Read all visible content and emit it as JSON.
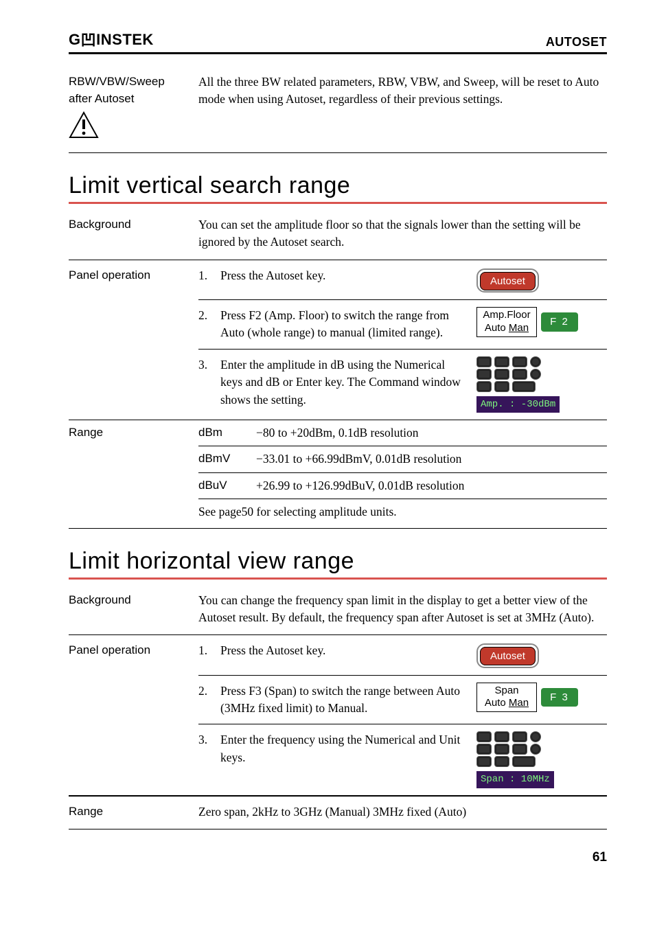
{
  "header": {
    "logo": "GW INSTEK",
    "title": "AUTOSET"
  },
  "rbw_row": {
    "left1": "RBW/VBW/Sweep",
    "left2": "after Autoset",
    "body": "All the three BW related parameters, RBW, VBW, and Sweep, will be reset to Auto mode when using Autoset, regardless of their previous settings."
  },
  "limit_vertical": {
    "heading": "Limit vertical search range",
    "background_label": "Background",
    "background_text": "You can set the amplitude floor so that the signals lower than the setting will be ignored by the Autoset search.",
    "panel_label": "Panel operation",
    "step1_text": "Press the Autoset key.",
    "autoset_label": "Autoset",
    "step2_text": "Press F2 (Amp. Floor) to switch the range from Auto (whole range) to manual (limited range).",
    "soft1_l1": "Amp.Floor",
    "soft1_l2a": "Auto  ",
    "soft1_l2b": "Man",
    "f2_label": "F 2",
    "step3_text": "Enter the amplitude in dB using the Numerical keys and dB or Enter key. The Command window shows the setting.",
    "cmd1": "Amp. : -30dBm",
    "range_label": "Range",
    "range_rows": [
      {
        "unit": "dBm",
        "text": "−80 to +20dBm, 0.1dB resolution"
      },
      {
        "unit": "dBmV",
        "text": "−33.01 to +66.99dBmV, 0.01dB resolution"
      },
      {
        "unit": "dBuV",
        "text": "+26.99 to +126.99dBuV, 0.01dB resolution"
      }
    ],
    "range_footer": "See page50 for selecting amplitude units."
  },
  "limit_horizontal": {
    "heading": "Limit horizontal view range",
    "background_label": "Background",
    "background_text": "You can change the frequency span limit in the display to get a better view of the Autoset result. By default, the frequency span after Autoset is set at 3MHz (Auto).",
    "panel_label": "Panel operation",
    "step1_text": "Press the Autoset key.",
    "autoset_label": "Autoset",
    "step2_text": "Press F3 (Span) to switch the range between Auto (3MHz fixed limit) to Manual.",
    "soft2_l1": "Span",
    "soft2_l2a": "Auto ",
    "soft2_l2b": "Man",
    "f3_label": "F 3",
    "step3_text": "Enter the frequency using the Numerical and Unit keys.",
    "cmd2": "Span : 10MHz",
    "range_label": "Range",
    "range_text": "Zero span, 2kHz to 3GHz (Manual) 3MHz fixed (Auto)"
  },
  "page_number": "61"
}
